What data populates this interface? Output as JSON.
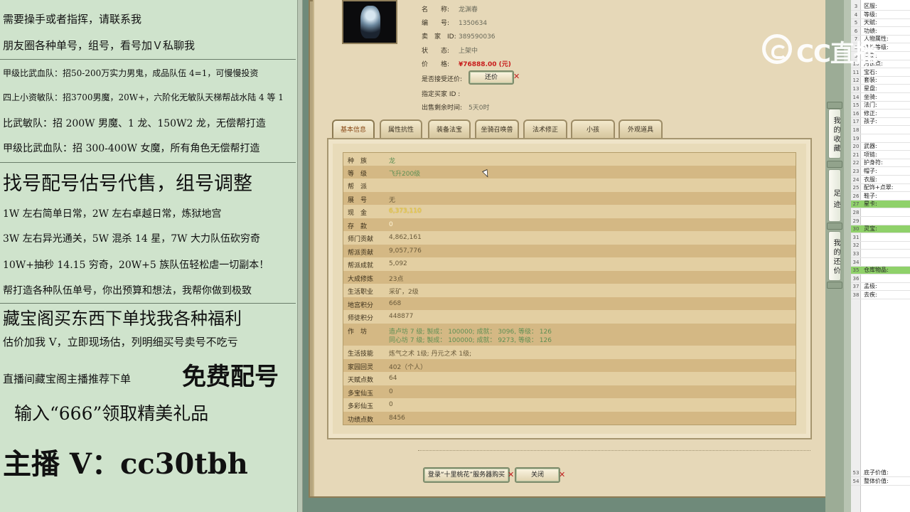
{
  "promo": {
    "lines": [
      "需要操手或者指挥，请联系我",
      "朋友圈各种单号，组号，看号加Ｖ私聊我",
      "甲级比武血队：招50-200万实力男鬼，成品队伍 4=1，可慢慢投资",
      "四上小资敏队：招3700男魔，20W+，六阶化无敏队天梯帮战水陆 4 等 1",
      "比武敏队：招 200W 男魔、1 龙、150W2 龙，无偿帮打造",
      "甲级比武血队：招 300-400W 女魔，所有角色无偿帮打造",
      "找号配号估号代售，组号调整",
      "1W 左右简单日常，2W 左右卓越日常，炼狱地宫",
      "3W 左右异光通关，5W 混杀 14 星，7W 大力队伍砍穷奇",
      "10W+抽秒 14.15 穷奇，20W+5 族队伍轻松虐一切副本！",
      "帮打造各种队伍单号，你出预算和想法，我帮你做到极致",
      "藏宝阁买东西下单找我各种福利",
      "估价加我 V，立即现场估，列明细买号卖号不吃亏",
      "直播间藏宝阁主播推荐下单",
      "免费配号",
      "输入“666”领取精美礼品",
      "主播 V：cc30tbh"
    ]
  },
  "item": {
    "fields": [
      {
        "k": "名　　称:",
        "v": "龙渊春"
      },
      {
        "k": "编　　号:",
        "v": "1350634"
      },
      {
        "k": "卖　家　ID:",
        "v": "389590036"
      },
      {
        "k": "状　　态:",
        "v": "上架中"
      },
      {
        "k": "价　　格:",
        "v": "¥76888.00 (元)"
      }
    ],
    "bargain_label": "是否接受还价:",
    "bargain_button": "还价",
    "designated_label": "指定买家 ID :",
    "time_label": "出售剩余时间:",
    "time_value": "5天0时"
  },
  "tabs": [
    "基本信息",
    "属性抗性",
    "装备法宝",
    "坐骑召唤兽",
    "法术修正",
    "小孩",
    "外观道具"
  ],
  "basic": [
    {
      "k": "种　族",
      "v": "龙",
      "c": "green"
    },
    {
      "k": "等　级",
      "v": "飞升200级",
      "c": "green"
    },
    {
      "k": "帮　派",
      "v": "",
      "c": ""
    },
    {
      "k": "展　号",
      "v": "无",
      "c": ""
    },
    {
      "k": "现　金",
      "v": "6,373,110",
      "c": "gold"
    },
    {
      "k": "存　款",
      "v": "0",
      "c": "white"
    },
    {
      "k": "师门贡献",
      "v": "4,862,161",
      "c": ""
    },
    {
      "k": "帮派贡献",
      "v": "9,057,776",
      "c": ""
    },
    {
      "k": "帮派成就",
      "v": "5,092",
      "c": ""
    },
    {
      "k": "大成修炼",
      "v": "23点",
      "c": ""
    },
    {
      "k": "生活职业",
      "v": "采矿，2级",
      "c": ""
    },
    {
      "k": "地宫积分",
      "v": "668",
      "c": ""
    },
    {
      "k": "师徒积分",
      "v": "448877",
      "c": ""
    },
    {
      "k": "生活技能",
      "v": "炼气之术 1级; 丹元之术 1级;",
      "c": ""
    },
    {
      "k": "家园回灵",
      "v": "402（个人）",
      "c": ""
    },
    {
      "k": "天赋点数",
      "v": "64",
      "c": ""
    },
    {
      "k": "多宝仙玉",
      "v": "0",
      "c": ""
    },
    {
      "k": "多彩仙玉",
      "v": "0",
      "c": ""
    },
    {
      "k": "功绩点数",
      "v": "8456",
      "c": ""
    }
  ],
  "workshop": {
    "label": "作　坊",
    "lines": [
      "造卢坊 7 级;  製成：  100000;   成就：  3096,   等级：  126",
      "同心坊 7 级;  製成：  100000;   成就：  9273,   等级：  126"
    ]
  },
  "buttons": {
    "login_buy": "登录“十里桃花”服务器购买",
    "close": "关闭"
  },
  "side_buttons": [
    "我的收藏",
    "足迹",
    "我的还价"
  ],
  "sheet": [
    {
      "n": "3",
      "t": "区服:"
    },
    {
      "n": "4",
      "t": "等级:"
    },
    {
      "n": "5",
      "t": "天赋:"
    },
    {
      "n": "6",
      "t": "功绩:"
    },
    {
      "n": "7",
      "t": "人物属性:"
    },
    {
      "n": "8",
      "t": "修炼等级:"
    },
    {
      "n": "9",
      "t": "回灵:"
    },
    {
      "n": "10",
      "t": "月饼点:"
    },
    {
      "n": "11",
      "t": "宝石:"
    },
    {
      "n": "12",
      "t": "套装:"
    },
    {
      "n": "13",
      "t": "星盘:"
    },
    {
      "n": "14",
      "t": "坐骑:"
    },
    {
      "n": "15",
      "t": "法门:"
    },
    {
      "n": "16",
      "t": "修正:"
    },
    {
      "n": "17",
      "t": "孩子:"
    },
    {
      "n": "18",
      "t": ""
    },
    {
      "n": "19",
      "t": ""
    },
    {
      "n": "20",
      "t": "武器:"
    },
    {
      "n": "21",
      "t": "项链:"
    },
    {
      "n": "22",
      "t": "护身符:"
    },
    {
      "n": "23",
      "t": "帽子:"
    },
    {
      "n": "24",
      "t": "衣服:"
    },
    {
      "n": "25",
      "t": "配饰+点翠:"
    },
    {
      "n": "26",
      "t": "鞋子:"
    },
    {
      "n": "27",
      "t": "星卡:"
    },
    {
      "n": "28",
      "t": ""
    },
    {
      "n": "29",
      "t": ""
    },
    {
      "n": "30",
      "t": "灵宝:"
    },
    {
      "n": "31",
      "t": ""
    },
    {
      "n": "32",
      "t": ""
    },
    {
      "n": "33",
      "t": ""
    },
    {
      "n": "34",
      "t": ""
    },
    {
      "n": "35",
      "t": "仓库物品:"
    },
    {
      "n": "36",
      "t": ""
    },
    {
      "n": "37",
      "t": "孟极:"
    },
    {
      "n": "38",
      "t": "去疾:"
    },
    {
      "n": "53",
      "t": "底子价值:"
    },
    {
      "n": "54",
      "t": "整体价值:"
    }
  ],
  "sheet_highlight_rows": [
    "27",
    "30",
    "35"
  ],
  "watermark": "CC直播",
  "colors": {
    "price": "#c81c1c",
    "gold_cash": "#f1d34c",
    "sheet_highlight": "#8fd16a",
    "promo_bg": "#cfe3cc"
  }
}
